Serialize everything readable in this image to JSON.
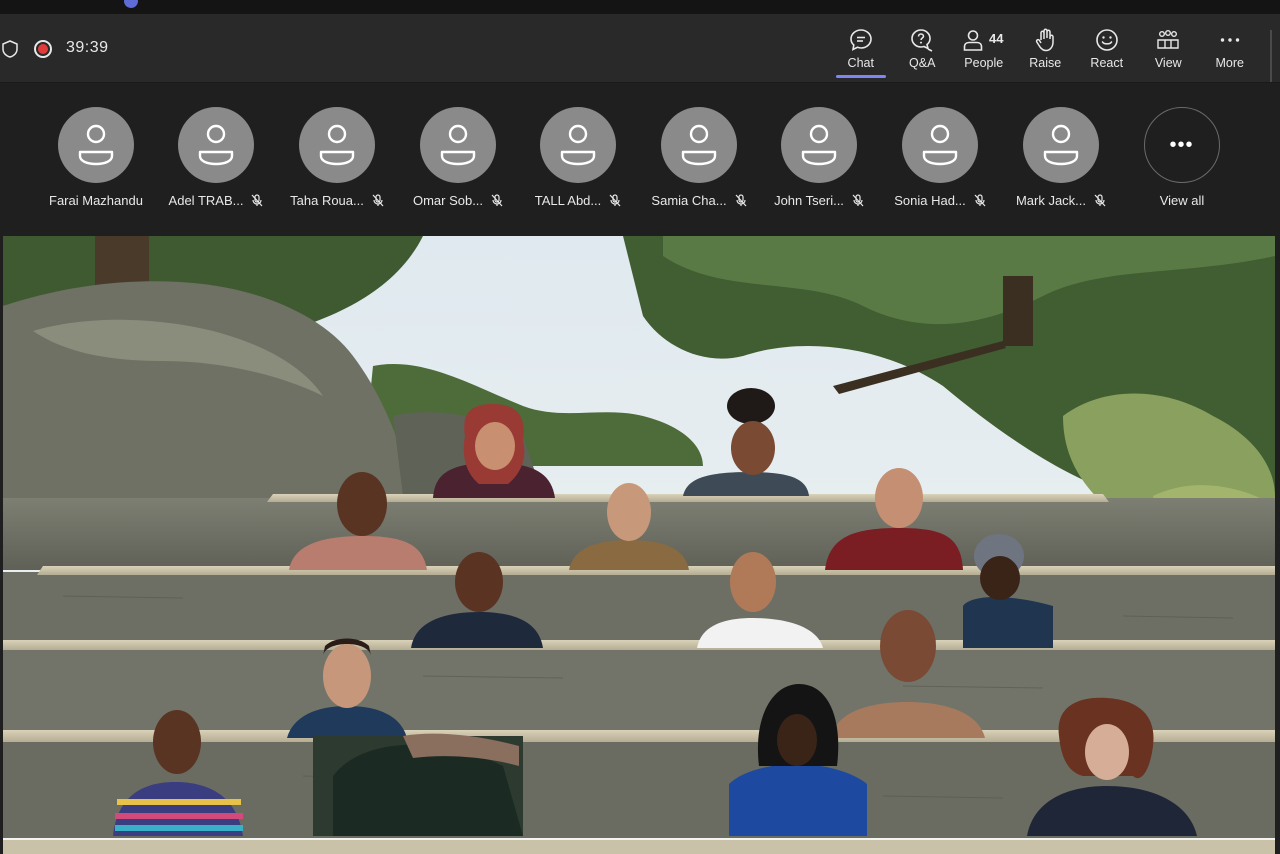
{
  "meeting": {
    "timer": "39:39"
  },
  "toolbar": {
    "items": [
      {
        "label": "Chat",
        "icon": "chat-icon",
        "active": true
      },
      {
        "label": "Q&A",
        "icon": "qa-icon"
      },
      {
        "label": "People",
        "icon": "people-icon",
        "badge": "44"
      },
      {
        "label": "Raise",
        "icon": "raise-hand-icon"
      },
      {
        "label": "React",
        "icon": "smiley-icon"
      },
      {
        "label": "View",
        "icon": "view-grid-icon"
      },
      {
        "label": "More",
        "icon": "more-icon"
      }
    ]
  },
  "participants": [
    {
      "name": "Farai Mazhandu",
      "muted": false
    },
    {
      "name": "Adel TRAB...",
      "muted": true
    },
    {
      "name": "Taha Roua...",
      "muted": true
    },
    {
      "name": "Omar Sob...",
      "muted": true
    },
    {
      "name": "TALL Abd...",
      "muted": true
    },
    {
      "name": "Samia Cha...",
      "muted": true
    },
    {
      "name": "John Tseri...",
      "muted": true
    },
    {
      "name": "Sonia Had...",
      "muted": true
    },
    {
      "name": "Mark Jack...",
      "muted": true
    }
  ],
  "view_all_label": "View all",
  "colors": {
    "accent": "#7f85f5",
    "record": "#e03a3a",
    "avatar": "#8a8a8a"
  }
}
